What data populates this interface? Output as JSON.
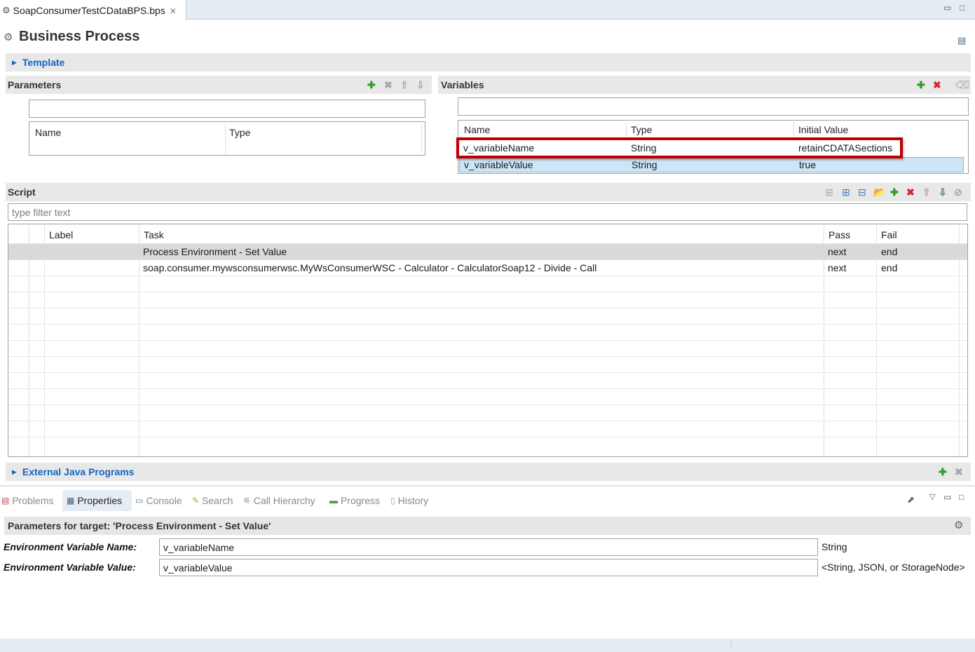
{
  "editor": {
    "tab_title": "SoapConsumerTestCDataBPS.bps",
    "close_glyph": "⨯",
    "page_title": "Business Process"
  },
  "template": {
    "title": "Template"
  },
  "parameters": {
    "title": "Parameters",
    "filter_value": "",
    "columns": [
      "Name",
      "Type"
    ]
  },
  "variables": {
    "title": "Variables",
    "filter_value": "",
    "columns": [
      "Name",
      "Type",
      "Initial Value"
    ],
    "rows": [
      {
        "name": "v_variableName",
        "type": "String",
        "initial_value": "retainCDATASections",
        "highlighted": true
      },
      {
        "name": "v_variableValue",
        "type": "String",
        "initial_value": "true",
        "selected": true
      }
    ]
  },
  "script": {
    "title": "Script",
    "filter_placeholder": "type filter text",
    "columns": [
      "Label",
      "Task",
      "Pass",
      "Fail"
    ],
    "rows": [
      {
        "label": "",
        "task": "Process Environment - Set Value",
        "pass": "next",
        "fail": "end",
        "selected": true
      },
      {
        "label": "",
        "task": "soap.consumer.mywsconsumerwsc.MyWsConsumerWSC - Calculator - CalculatorSoap12 - Divide - Call",
        "pass": "next",
        "fail": "end"
      }
    ]
  },
  "external_java": {
    "title": "External Java Programs"
  },
  "bottom_tabs": [
    {
      "label": "Problems",
      "icon": "problems-icon",
      "active": false
    },
    {
      "label": "Properties",
      "icon": "properties-icon",
      "active": true
    },
    {
      "label": "Console",
      "icon": "console-icon",
      "active": false
    },
    {
      "label": "Search",
      "icon": "search-icon",
      "active": false
    },
    {
      "label": "Call Hierarchy",
      "icon": "call-hierarchy-icon",
      "active": false
    },
    {
      "label": "Progress",
      "icon": "progress-icon",
      "active": false
    },
    {
      "label": "History",
      "icon": "history-icon",
      "active": false
    }
  ],
  "properties": {
    "header": "Parameters for target: 'Process Environment - Set Value'",
    "fields": [
      {
        "label": "Environment Variable Name:",
        "value": "v_variableName",
        "type_hint": "String"
      },
      {
        "label": "Environment Variable Value:",
        "value": "v_variableValue",
        "type_hint": "<String, JSON, or StorageNode>"
      }
    ]
  },
  "colors": {
    "highlight_border": "#c00000",
    "selection_bg": "#cde6f7",
    "row_selected_bg": "#d9d9d9",
    "link_blue": "#1565c0",
    "add_green": "#2e9b2e",
    "delete_red": "#d9232a"
  }
}
